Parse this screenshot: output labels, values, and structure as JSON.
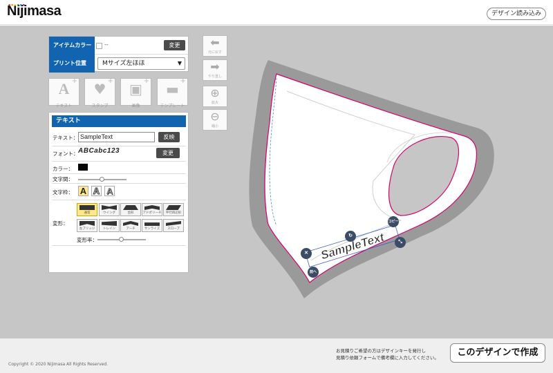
{
  "header": {
    "logo": "Nijimasa",
    "load_button": "デザイン読み込み"
  },
  "item_panel": {
    "item_color_label": "アイテムカラー",
    "item_color_value": "--",
    "change_button": "変更",
    "print_position_label": "プリント位置",
    "print_position_value": "Mサイズ左ほほ"
  },
  "tools": [
    {
      "label": "テキスト",
      "icon": "text-add-icon"
    },
    {
      "label": "スタンプ",
      "icon": "stamp-add-icon"
    },
    {
      "label": "画像",
      "icon": "image-add-icon"
    },
    {
      "label": "テンプレート",
      "icon": "template-add-icon"
    }
  ],
  "text_panel": {
    "title": "テキスト",
    "text_label": "テキスト：",
    "text_value": "SampleText",
    "apply_button": "反映",
    "font_label": "フォント：",
    "font_sample": "ABCabc123",
    "font_change_button": "変更",
    "color_label": "カラー：",
    "color_value": "#000000",
    "spacing_label": "文字間：",
    "frame_label": "文字枠：",
    "frame_options": [
      "A",
      "A",
      "A"
    ],
    "warp_label": "変形：",
    "warp_options": [
      "通常",
      "ウイング",
      "台形",
      "アドポリーチ",
      "平行四辺形",
      "左ブリッジ",
      "トレイン",
      "アーチ",
      "サンライズ",
      "スロープ"
    ],
    "warp_rate_label": "変形率："
  },
  "side_nav": [
    {
      "label": "元に戻す",
      "icon": "undo-arrow-icon"
    },
    {
      "label": "やり直し",
      "icon": "redo-arrow-icon"
    },
    {
      "label": "拡大",
      "icon": "zoom-in-icon"
    },
    {
      "label": "縮小",
      "icon": "zoom-out-icon"
    }
  ],
  "canvas": {
    "sample_text": "SampleText",
    "copy_label": "コピー",
    "front_label": "前へ",
    "accent_color": "#d6006f",
    "guide_color": "#3a8fd0"
  },
  "footer": {
    "copyright": "Copyright © 2020 Nijimasa All Rights Reserved.",
    "note_line1": "お見積りご希望の方はデザインキーを発行し",
    "note_line2": "見積り依頼フォームで備考欄に入力してください。",
    "create_button": "このデザインで作成"
  }
}
